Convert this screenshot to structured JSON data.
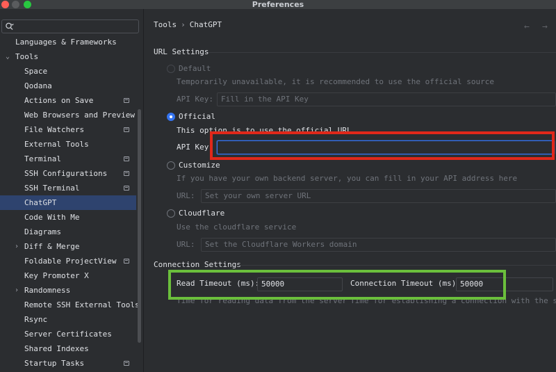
{
  "window": {
    "title": "Preferences"
  },
  "search": {
    "placeholder": ""
  },
  "sidebar": {
    "items": [
      {
        "label": "Languages & Frameworks",
        "indent": 0,
        "chevron": "",
        "project_icon": false,
        "selected": false
      },
      {
        "label": "Tools",
        "indent": 0,
        "chevron": "⌄",
        "project_icon": false,
        "selected": false
      },
      {
        "label": "Space",
        "indent": 1,
        "chevron": "",
        "project_icon": false,
        "selected": false
      },
      {
        "label": "Qodana",
        "indent": 1,
        "chevron": "",
        "project_icon": false,
        "selected": false
      },
      {
        "label": "Actions on Save",
        "indent": 1,
        "chevron": "",
        "project_icon": true,
        "selected": false
      },
      {
        "label": "Web Browsers and Preview",
        "indent": 1,
        "chevron": "",
        "project_icon": false,
        "selected": false
      },
      {
        "label": "File Watchers",
        "indent": 1,
        "chevron": "",
        "project_icon": true,
        "selected": false
      },
      {
        "label": "External Tools",
        "indent": 1,
        "chevron": "",
        "project_icon": false,
        "selected": false
      },
      {
        "label": "Terminal",
        "indent": 1,
        "chevron": "",
        "project_icon": true,
        "selected": false
      },
      {
        "label": "SSH Configurations",
        "indent": 1,
        "chevron": "",
        "project_icon": true,
        "selected": false
      },
      {
        "label": "SSH Terminal",
        "indent": 1,
        "chevron": "",
        "project_icon": true,
        "selected": false
      },
      {
        "label": "ChatGPT",
        "indent": 1,
        "chevron": "",
        "project_icon": false,
        "selected": true
      },
      {
        "label": "Code With Me",
        "indent": 1,
        "chevron": "",
        "project_icon": false,
        "selected": false
      },
      {
        "label": "Diagrams",
        "indent": 1,
        "chevron": "",
        "project_icon": false,
        "selected": false
      },
      {
        "label": "Diff & Merge",
        "indent": 1,
        "chevron": "›",
        "project_icon": false,
        "selected": false
      },
      {
        "label": "Foldable ProjectView",
        "indent": 1,
        "chevron": "",
        "project_icon": true,
        "selected": false
      },
      {
        "label": "Key Promoter X",
        "indent": 1,
        "chevron": "",
        "project_icon": false,
        "selected": false
      },
      {
        "label": "Randomness",
        "indent": 1,
        "chevron": "›",
        "project_icon": false,
        "selected": false
      },
      {
        "label": "Remote SSH External Tools",
        "indent": 1,
        "chevron": "",
        "project_icon": false,
        "selected": false
      },
      {
        "label": "Rsync",
        "indent": 1,
        "chevron": "",
        "project_icon": false,
        "selected": false
      },
      {
        "label": "Server Certificates",
        "indent": 1,
        "chevron": "",
        "project_icon": false,
        "selected": false
      },
      {
        "label": "Shared Indexes",
        "indent": 1,
        "chevron": "",
        "project_icon": false,
        "selected": false
      },
      {
        "label": "Startup Tasks",
        "indent": 1,
        "chevron": "",
        "project_icon": true,
        "selected": false
      }
    ]
  },
  "breadcrumb": {
    "parent": "Tools",
    "separator": "›",
    "current": "ChatGPT",
    "back_arrow": "←",
    "forward_arrow": "→"
  },
  "url_settings": {
    "title": "URL Settings",
    "default": {
      "label": "Default",
      "description": "Temporarily unavailable, it is recommended to use the official source",
      "field_label": "API Key:",
      "placeholder": "Fill in the API Key",
      "value": ""
    },
    "official": {
      "label": "Official",
      "description": "This option is to use the official URL",
      "field_label": "API Key:",
      "value": ""
    },
    "customize": {
      "label": "Customize",
      "description": "If you have your own backend server, you can fill in your API address here",
      "field_label": "URL:",
      "placeholder": "Set your own server URL",
      "value": ""
    },
    "cloudflare": {
      "label": "Cloudflare",
      "description": "Use the cloudflare service",
      "field_label": "URL:",
      "placeholder": "Set the Cloudflare Workers domain",
      "value": ""
    },
    "selected": "official"
  },
  "connection_settings": {
    "title": "Connection Settings",
    "read_timeout": {
      "label": "Read Timeout (ms):",
      "value": "50000",
      "hint": "Time for reading data from the server"
    },
    "connection_timeout": {
      "label": "Connection Timeout (ms):",
      "value": "50000",
      "hint": "Time for establishing a connection with the server"
    }
  },
  "colors": {
    "accent": "#3574f0",
    "selection": "#2e436e",
    "highlight_red": "#e0281a",
    "highlight_green": "#6bbf3c"
  }
}
